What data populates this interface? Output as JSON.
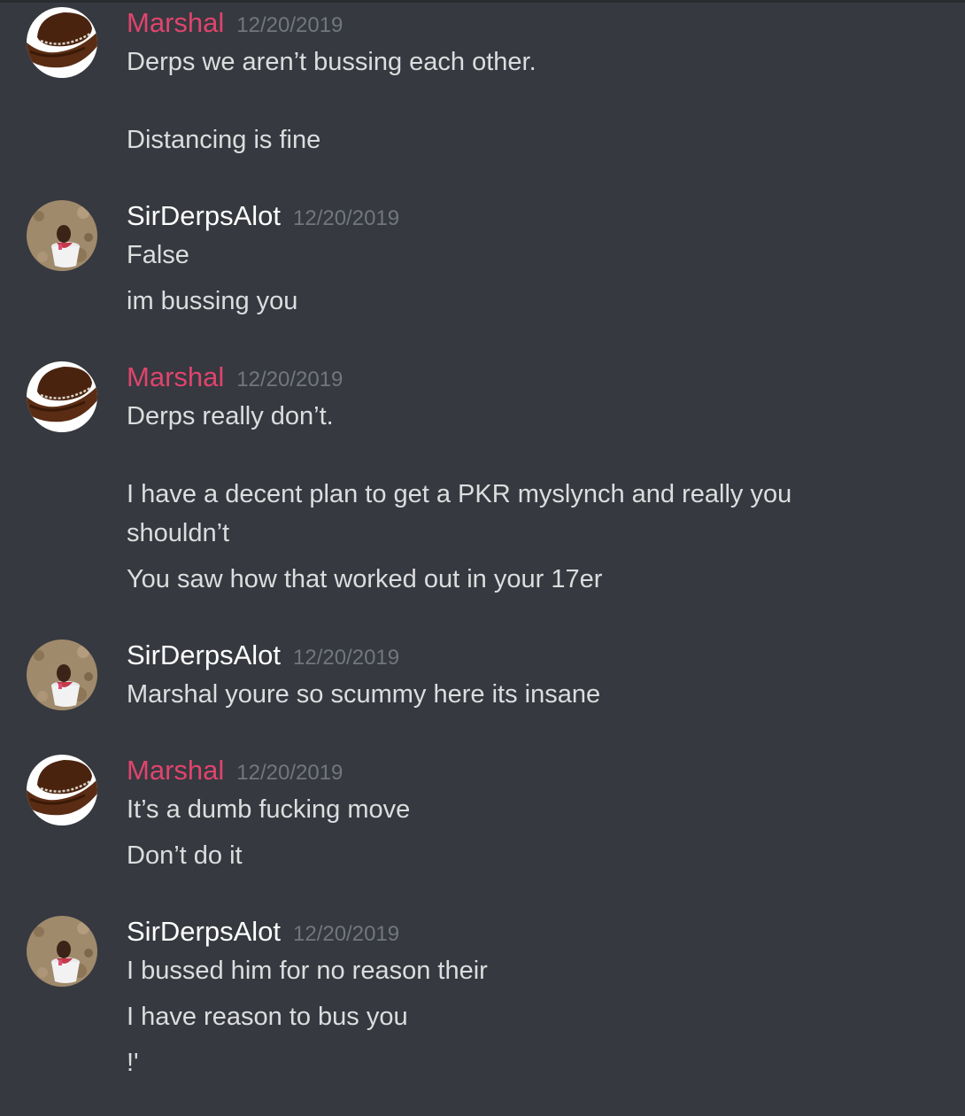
{
  "colors": {
    "background": "#36393f",
    "marshal_name": "#e0446d",
    "derps_name": "#ffffff",
    "message_text": "#dcddde",
    "timestamp": "#72767d"
  },
  "messages": [
    {
      "author": "Marshal",
      "avatar": "cowboy-hat-avatar",
      "timestamp": "12/20/2019",
      "lines": [
        "Derps we aren’t bussing each other.",
        "Distancing is fine"
      ]
    },
    {
      "author": "SirDerpsAlot",
      "avatar": "child-in-bucket-avatar",
      "timestamp": "12/20/2019",
      "lines": [
        "False",
        "im bussing you"
      ]
    },
    {
      "author": "Marshal",
      "avatar": "cowboy-hat-avatar",
      "timestamp": "12/20/2019",
      "lines": [
        "Derps really don’t.",
        "I have a decent plan to get a PKR myslynch and really you shouldn’t",
        "You saw how that worked out in your 17er"
      ]
    },
    {
      "author": "SirDerpsAlot",
      "avatar": "child-in-bucket-avatar",
      "timestamp": "12/20/2019",
      "lines": [
        "Marshal youre so scummy here its insane"
      ]
    },
    {
      "author": "Marshal",
      "avatar": "cowboy-hat-avatar",
      "timestamp": "12/20/2019",
      "lines": [
        "It’s a dumb fucking move",
        "Don’t do it"
      ]
    },
    {
      "author": "SirDerpsAlot",
      "avatar": "child-in-bucket-avatar",
      "timestamp": "12/20/2019",
      "lines": [
        "I bussed him for no reason their",
        "I have reason to bus you",
        "!'"
      ]
    }
  ]
}
